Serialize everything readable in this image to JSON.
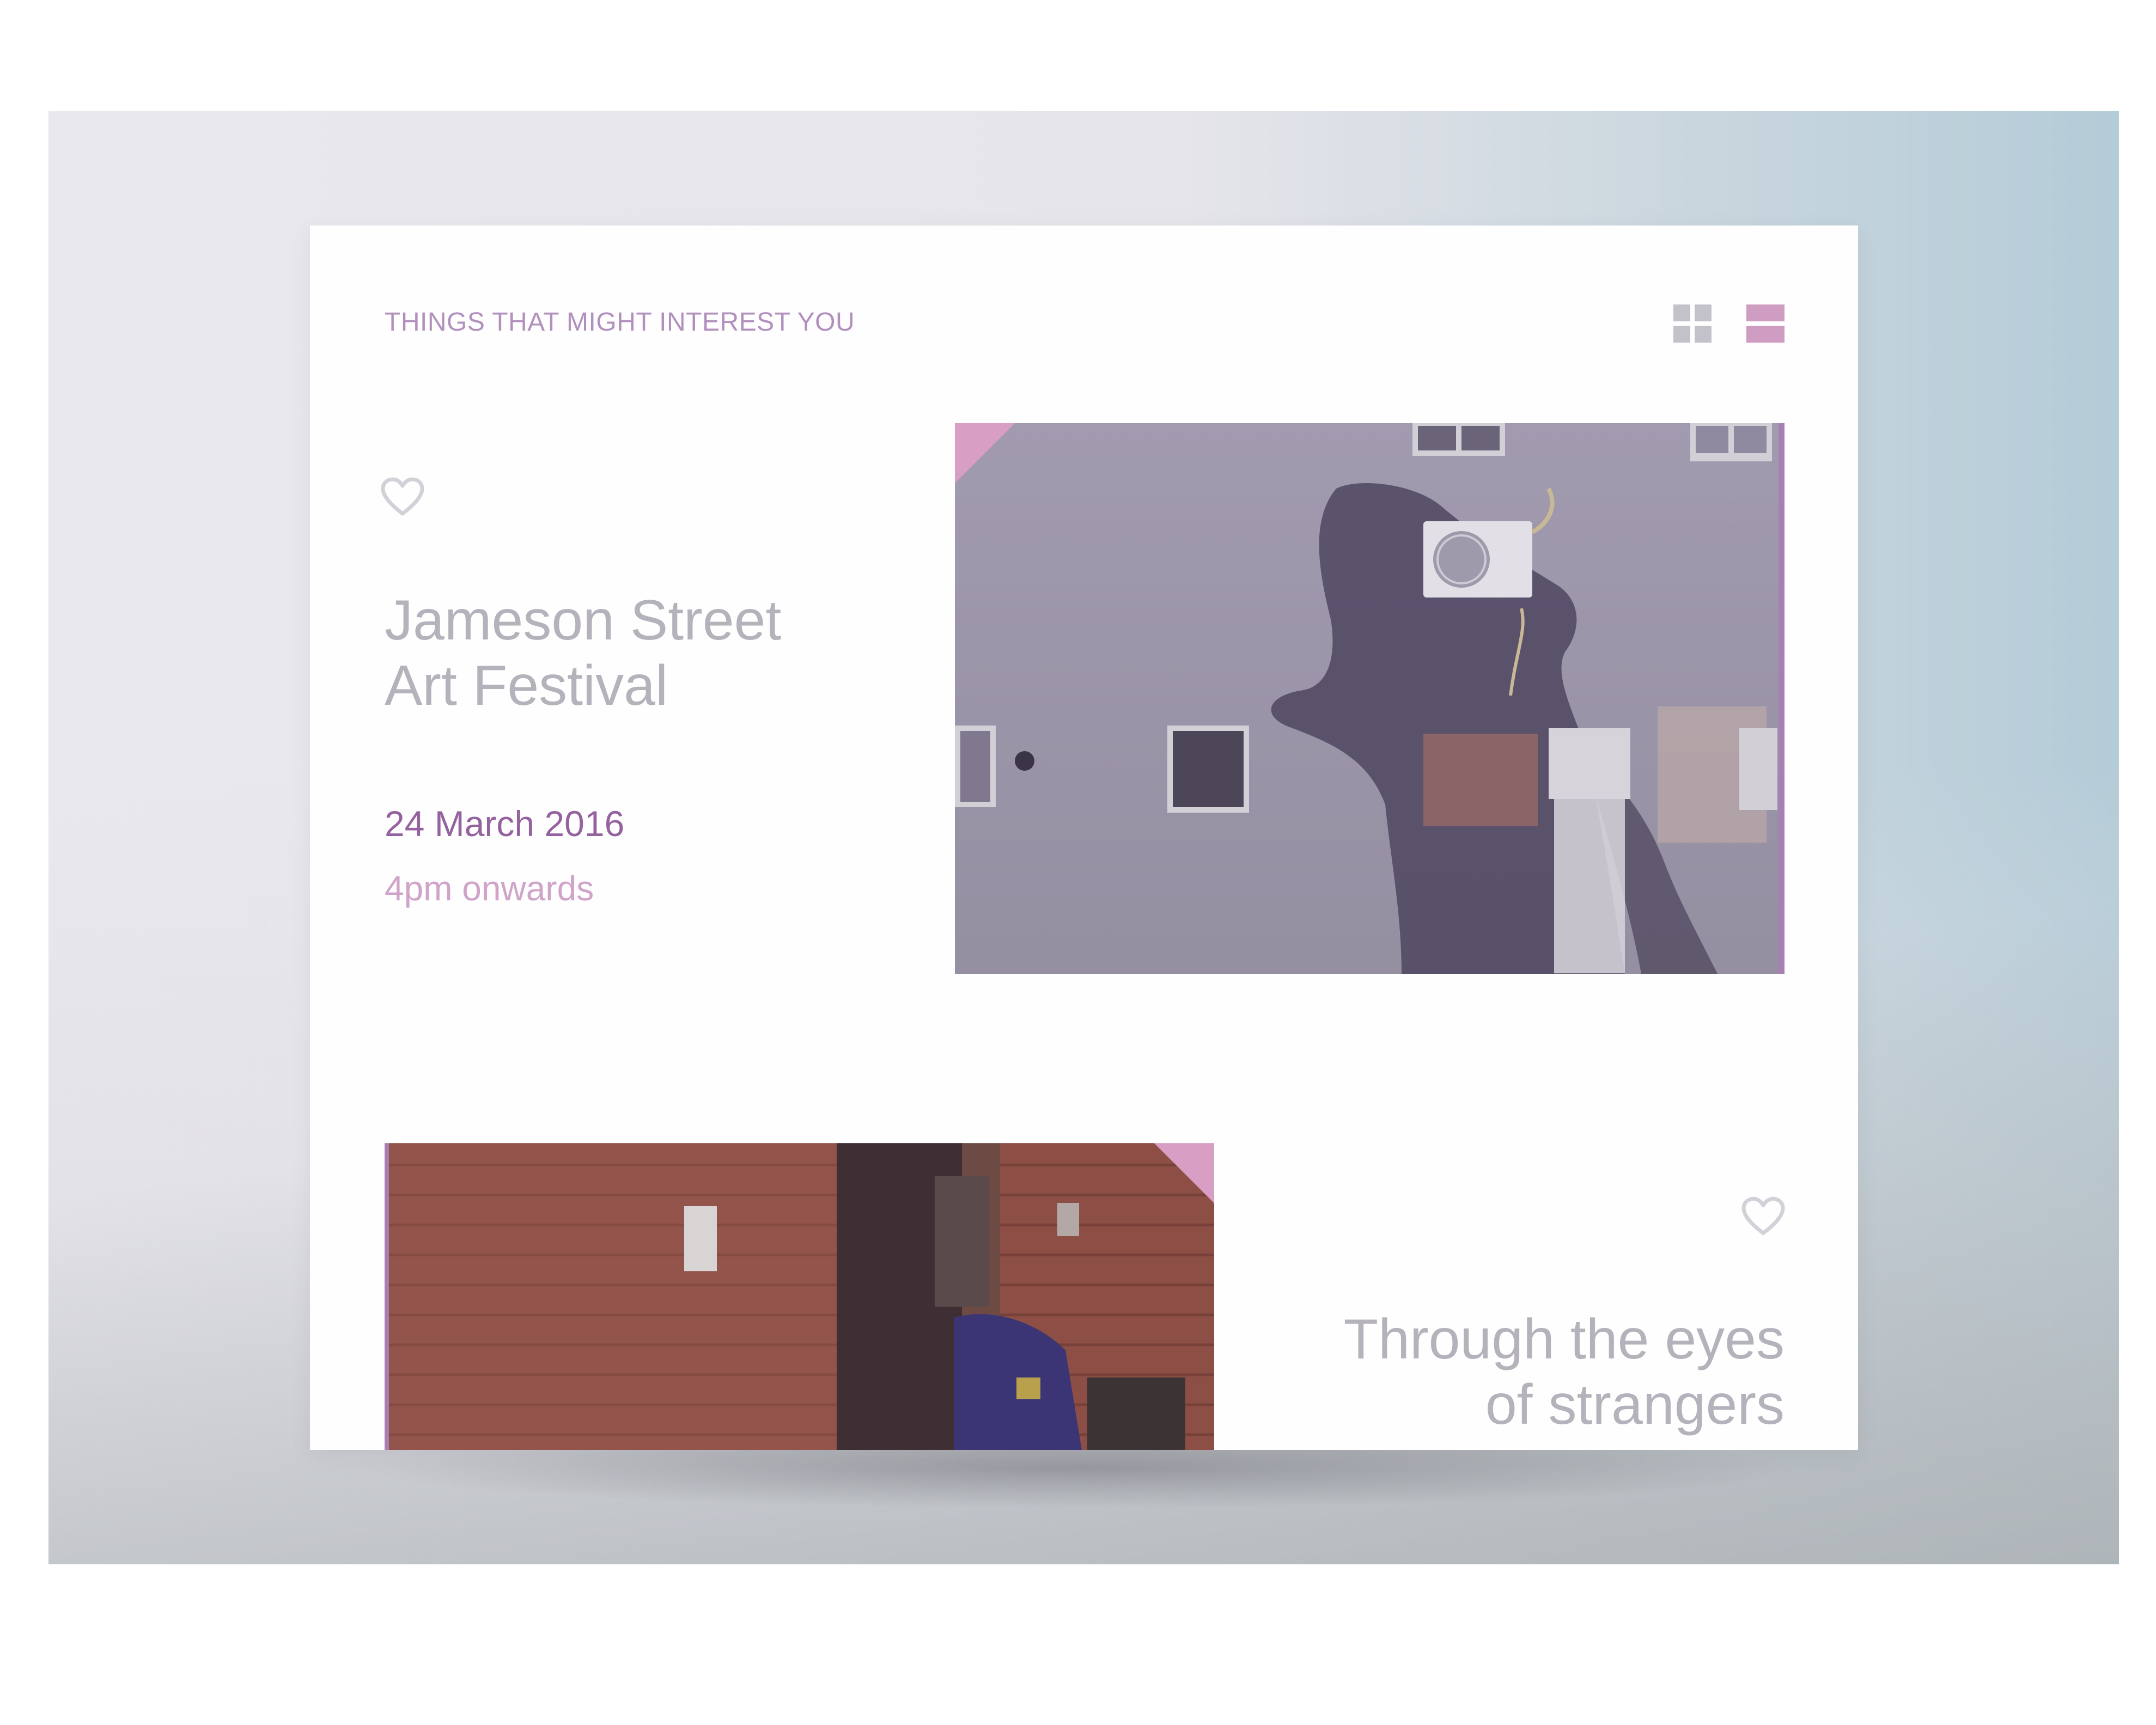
{
  "section": {
    "title": "THINGS THAT MIGHT INTEREST YOU"
  },
  "view_toggles": [
    {
      "icon": "grid-view-icon",
      "active": false
    },
    {
      "icon": "list-view-icon",
      "active": true
    }
  ],
  "events": [
    {
      "title_lines": [
        "Jameson Street",
        "Art Festival"
      ],
      "date": "24 March 2016",
      "time": "4pm onwards",
      "favorite_icon": "heart-icon",
      "image": "weathered-building-wall-with-air-conditioner"
    },
    {
      "title_lines": [
        "Through the eyes",
        "of strangers"
      ],
      "favorite_icon": "heart-icon",
      "image": "red-brick-alley"
    }
  ],
  "colors": {
    "accent": "#b290be",
    "date": "#94629e",
    "time": "#d0a3c8",
    "title": "#b5b2bb",
    "corner_tab": "#d89ec4"
  }
}
